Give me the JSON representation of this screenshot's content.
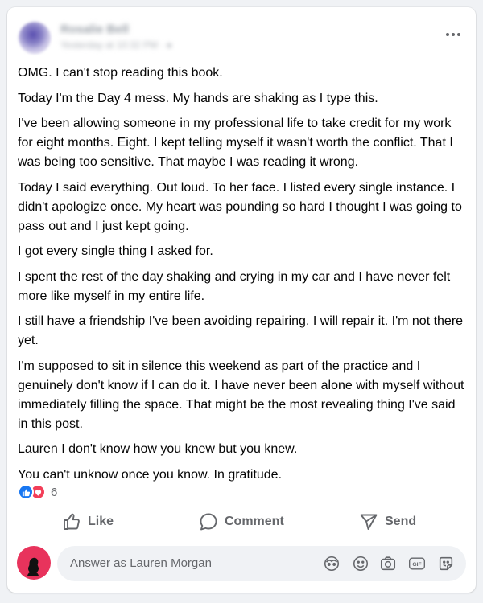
{
  "post": {
    "author_name": "Rosalie Bell",
    "timestamp": "Yesterday at 10:32 PM · ",
    "paragraphs": [
      "OMG. I can't stop reading this book.",
      "Today I'm the Day 4 mess. My hands are shaking as I type this.",
      "I've been allowing someone in my professional life to take credit for my work for eight months. Eight. I kept telling myself it wasn't worth the conflict. That I was being too sensitive. That maybe I was reading it wrong.",
      "Today I said everything. Out loud. To her face. I listed every single instance. I didn't apologize once. My heart was pounding so hard I thought I was going to pass out and I just kept going.",
      "I got every single thing I asked for.",
      "I spent the rest of the day shaking and crying in my car and I have never felt more like myself in my entire life.",
      "I still have a friendship I've been avoiding repairing. I will repair it. I'm not there yet.",
      "I'm supposed to sit in silence this weekend as part of the practice and I genuinely don't know if I can do it. I have never been alone with myself without immediately filling the space. That might be the most revealing thing I've said in this post.",
      "Lauren I don't know how you knew but you knew.",
      "You can't unknow once you know. In gratitude."
    ]
  },
  "reactions": {
    "count": "6"
  },
  "actions": {
    "like": "Like",
    "comment": "Comment",
    "send": "Send"
  },
  "comment_box": {
    "placeholder": "Answer as Lauren Morgan"
  },
  "colors": {
    "brand_blue": "#1877f2",
    "love_red": "#f33e58",
    "avatar_pink": "#e8335c"
  }
}
